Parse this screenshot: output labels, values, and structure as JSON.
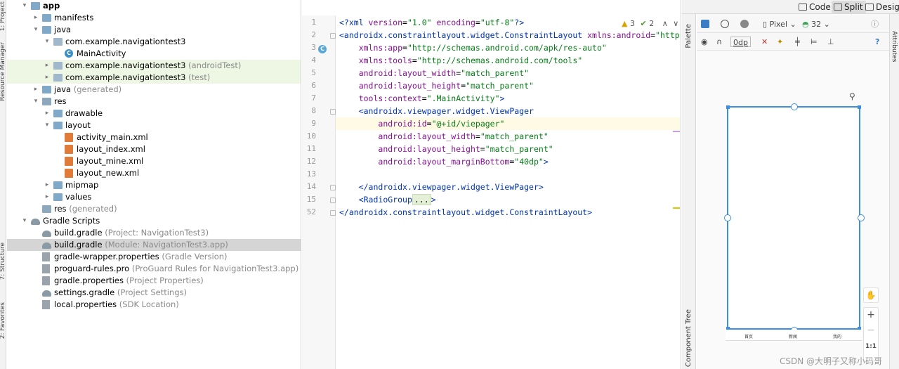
{
  "side_strip": {
    "labels": [
      "1: Project",
      "Resource Manager",
      "7: Structure",
      "2: Favorites"
    ]
  },
  "tree": {
    "rows": [
      {
        "label": "app",
        "hint": "",
        "indent": 0,
        "arrow": "▾",
        "icon": "folder",
        "bold": true
      },
      {
        "label": "manifests",
        "hint": "",
        "indent": 1,
        "arrow": "▸",
        "icon": "folder"
      },
      {
        "label": "java",
        "hint": "",
        "indent": 1,
        "arrow": "▾",
        "icon": "folder"
      },
      {
        "label": "com.example.navigationtest3",
        "hint": "",
        "indent": 2,
        "arrow": "▾",
        "icon": "pkg"
      },
      {
        "label": "MainActivity",
        "hint": "",
        "indent": 3,
        "arrow": "",
        "icon": "class"
      },
      {
        "label": "com.example.navigationtest3",
        "hint": " (androidTest)",
        "indent": 2,
        "arrow": "▸",
        "icon": "pkg",
        "green": true
      },
      {
        "label": "com.example.navigationtest3",
        "hint": " (test)",
        "indent": 2,
        "arrow": "▸",
        "icon": "pkg",
        "green": true
      },
      {
        "label": "java",
        "hint": " (generated)",
        "indent": 1,
        "arrow": "▸",
        "icon": "folder"
      },
      {
        "label": "res",
        "hint": "",
        "indent": 1,
        "arrow": "▾",
        "icon": "res"
      },
      {
        "label": "drawable",
        "hint": "",
        "indent": 2,
        "arrow": "▸",
        "icon": "folder"
      },
      {
        "label": "layout",
        "hint": "",
        "indent": 2,
        "arrow": "▾",
        "icon": "folder"
      },
      {
        "label": "activity_main.xml",
        "hint": "",
        "indent": 3,
        "arrow": "",
        "icon": "xml"
      },
      {
        "label": "layout_index.xml",
        "hint": "",
        "indent": 3,
        "arrow": "",
        "icon": "xml"
      },
      {
        "label": "layout_mine.xml",
        "hint": "",
        "indent": 3,
        "arrow": "",
        "icon": "xml"
      },
      {
        "label": "layout_new.xml",
        "hint": "",
        "indent": 3,
        "arrow": "",
        "icon": "xml"
      },
      {
        "label": "mipmap",
        "hint": "",
        "indent": 2,
        "arrow": "▸",
        "icon": "folder"
      },
      {
        "label": "values",
        "hint": "",
        "indent": 2,
        "arrow": "▸",
        "icon": "folder"
      },
      {
        "label": "res",
        "hint": " (generated)",
        "indent": 1,
        "arrow": "",
        "icon": "res"
      },
      {
        "label": "Gradle Scripts",
        "hint": "",
        "indent": 0,
        "arrow": "▾",
        "icon": "gradle"
      },
      {
        "label": "build.gradle",
        "hint": " (Project: NavigationTest3)",
        "indent": 1,
        "arrow": "",
        "icon": "gradle"
      },
      {
        "label": "build.gradle",
        "hint": " (Module: NavigationTest3.app)",
        "indent": 1,
        "arrow": "",
        "icon": "gradle",
        "selected": true
      },
      {
        "label": "gradle-wrapper.properties",
        "hint": " (Gradle Version)",
        "indent": 1,
        "arrow": "",
        "icon": "props"
      },
      {
        "label": "proguard-rules.pro",
        "hint": " (ProGuard Rules for NavigationTest3.app)",
        "indent": 1,
        "arrow": "",
        "icon": "props"
      },
      {
        "label": "gradle.properties",
        "hint": " (Project Properties)",
        "indent": 1,
        "arrow": "",
        "icon": "props"
      },
      {
        "label": "settings.gradle",
        "hint": " (Project Settings)",
        "indent": 1,
        "arrow": "",
        "icon": "gradle"
      },
      {
        "label": "local.properties",
        "hint": " (SDK Location)",
        "indent": 1,
        "arrow": "",
        "icon": "props"
      }
    ]
  },
  "editor": {
    "inspection": {
      "warnings": "3",
      "weak_warnings": "2"
    },
    "lines": [
      {
        "n": "1",
        "parts": [
          [
            "tg",
            "<?xml "
          ],
          [
            "an",
            "version"
          ],
          [
            "pl",
            "="
          ],
          [
            "av",
            "\"1.0\" "
          ],
          [
            "an",
            "encoding"
          ],
          [
            "pl",
            "="
          ],
          [
            "av",
            "\"utf-8\""
          ],
          [
            "tg",
            "?>"
          ]
        ]
      },
      {
        "n": "2",
        "parts": [
          [
            "tg",
            "<androidx.constraintlayout.widget.ConstraintLayout "
          ],
          [
            "an",
            "xmlns:android"
          ],
          [
            "pl",
            "="
          ],
          [
            "av",
            "\"http:"
          ]
        ]
      },
      {
        "n": "3",
        "parts": [
          [
            "pl",
            "    "
          ],
          [
            "an",
            "xmlns:app"
          ],
          [
            "pl",
            "="
          ],
          [
            "av",
            "\"http://schemas.android.com/apk/res-auto\""
          ]
        ]
      },
      {
        "n": "4",
        "parts": [
          [
            "pl",
            "    "
          ],
          [
            "an",
            "xmlns:tools"
          ],
          [
            "pl",
            "="
          ],
          [
            "av",
            "\"http://schemas.android.com/tools\""
          ]
        ]
      },
      {
        "n": "5",
        "parts": [
          [
            "pl",
            "    "
          ],
          [
            "an",
            "android:layout_width"
          ],
          [
            "pl",
            "="
          ],
          [
            "av",
            "\"match_parent\""
          ]
        ]
      },
      {
        "n": "6",
        "parts": [
          [
            "pl",
            "    "
          ],
          [
            "an",
            "android:layout_height"
          ],
          [
            "pl",
            "="
          ],
          [
            "av",
            "\"match_parent\""
          ]
        ]
      },
      {
        "n": "7",
        "parts": [
          [
            "pl",
            "    "
          ],
          [
            "an",
            "tools:context"
          ],
          [
            "pl",
            "="
          ],
          [
            "av",
            "\".MainActivity\""
          ],
          [
            "tg",
            ">"
          ]
        ]
      },
      {
        "n": "8",
        "parts": [
          [
            "pl",
            "    "
          ],
          [
            "tg",
            "<androidx.viewpager.widget.ViewPager"
          ]
        ]
      },
      {
        "n": "9",
        "parts": [
          [
            "pl",
            "        "
          ],
          [
            "an",
            "android:id"
          ],
          [
            "pl",
            "="
          ],
          [
            "av",
            "\"@+id/viepager\""
          ]
        ],
        "current": true
      },
      {
        "n": "10",
        "parts": [
          [
            "pl",
            "        "
          ],
          [
            "an",
            "android:layout_width"
          ],
          [
            "pl",
            "="
          ],
          [
            "av",
            "\"match_parent\""
          ]
        ]
      },
      {
        "n": "11",
        "parts": [
          [
            "pl",
            "        "
          ],
          [
            "an",
            "android:layout_height"
          ],
          [
            "pl",
            "="
          ],
          [
            "av",
            "\"match_parent\""
          ]
        ]
      },
      {
        "n": "12",
        "parts": [
          [
            "pl",
            "        "
          ],
          [
            "an",
            "android:layout_marginBottom"
          ],
          [
            "pl",
            "="
          ],
          [
            "av",
            "\"40dp\""
          ],
          [
            "tg",
            ">"
          ]
        ]
      },
      {
        "n": "13",
        "parts": []
      },
      {
        "n": "14",
        "parts": [
          [
            "pl",
            "    "
          ],
          [
            "tg",
            "</androidx.viewpager.widget.ViewPager>"
          ]
        ]
      },
      {
        "n": "15",
        "parts": [
          [
            "pl",
            "    "
          ],
          [
            "tg",
            "<RadioGroup"
          ],
          [
            "fold",
            "..."
          ],
          [
            "tg",
            ">"
          ]
        ]
      },
      {
        "n": "52",
        "parts": [
          [
            "tg",
            "</androidx.constraintlayout.widget.ConstraintLayout>"
          ]
        ]
      }
    ]
  },
  "mode_bar": {
    "code": "Code",
    "split": "Split",
    "design": "Design"
  },
  "design_toolbar": {
    "device": "Pixel",
    "api": "32",
    "margin": "0dp",
    "help": "?"
  },
  "palette_tabs": {
    "palette": "Palette",
    "component_tree": "Component Tree",
    "attributes": "Attributes"
  },
  "preview": {
    "tabs": [
      "首页",
      "新闻",
      "我的"
    ]
  },
  "zoom": {
    "plus": "+",
    "minus": "−",
    "one_to_one": "1:1"
  },
  "watermark": "CSDN @大明子又称小码哥"
}
